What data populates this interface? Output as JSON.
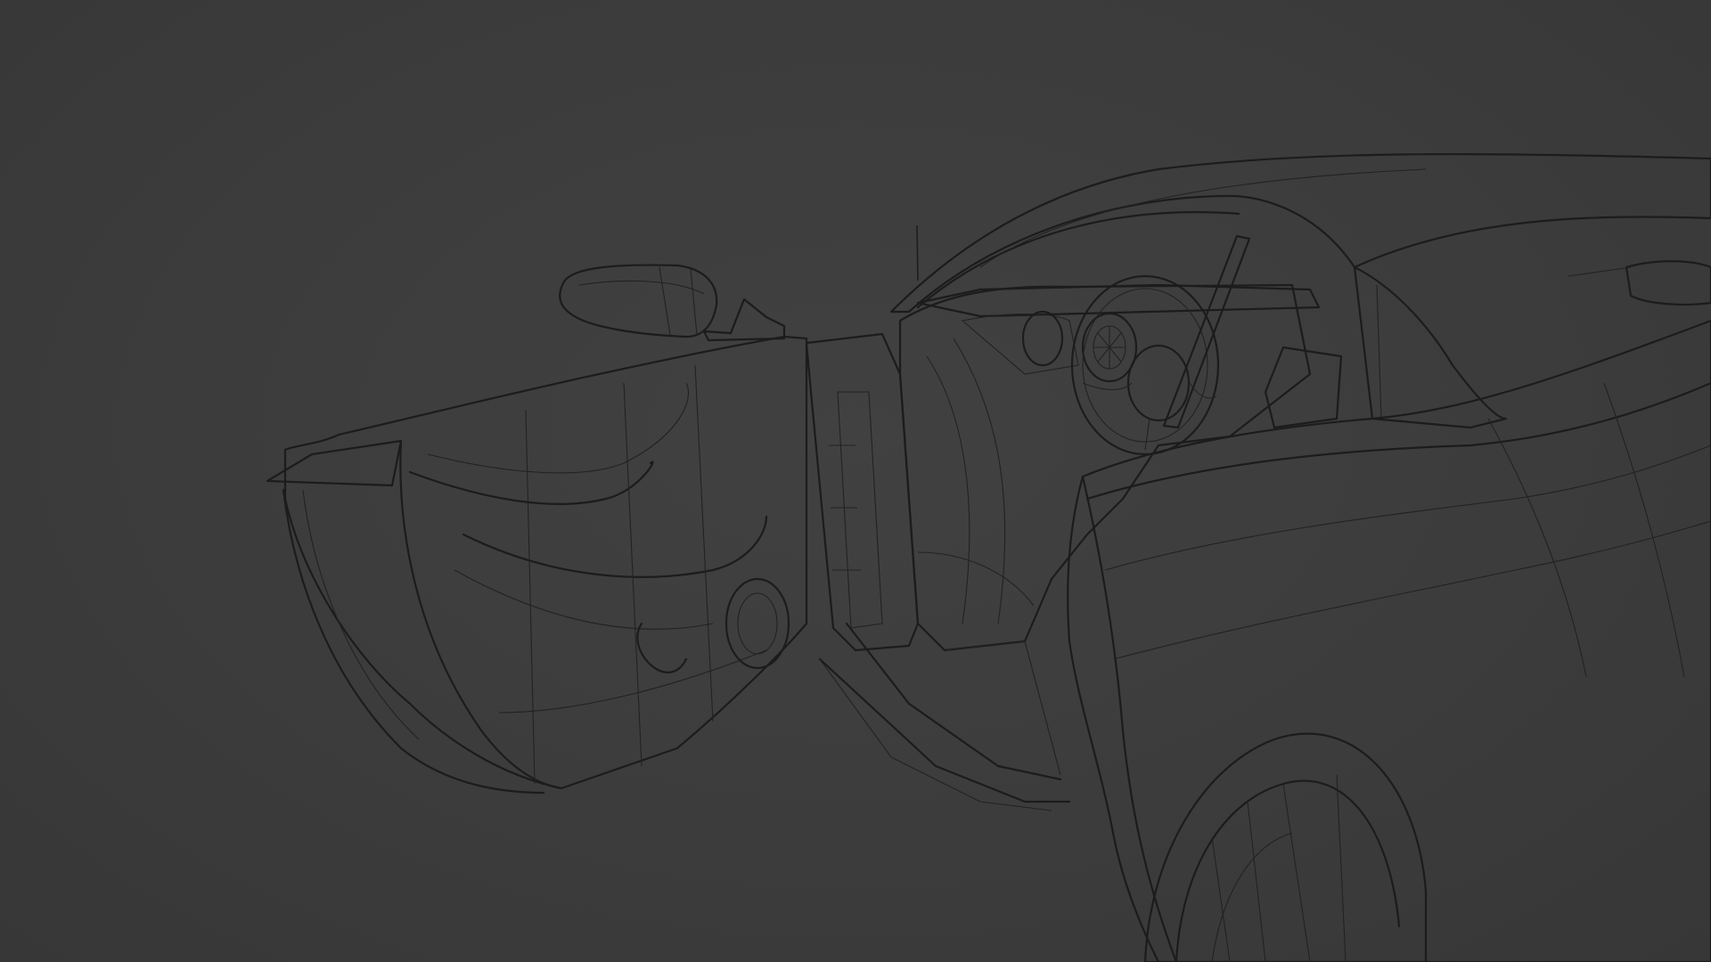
{
  "viewport": {
    "mode": "wireframe",
    "background": "#3b3b3b",
    "wire_color": "#1c1c1c"
  },
  "scene": {
    "subject": "car-model",
    "visible_parts": [
      "side-mirror",
      "open-door",
      "door-jamb",
      "dashboard",
      "steering-wheel",
      "a-pillar",
      "front-fender",
      "front-wheel",
      "hood",
      "windshield"
    ]
  }
}
